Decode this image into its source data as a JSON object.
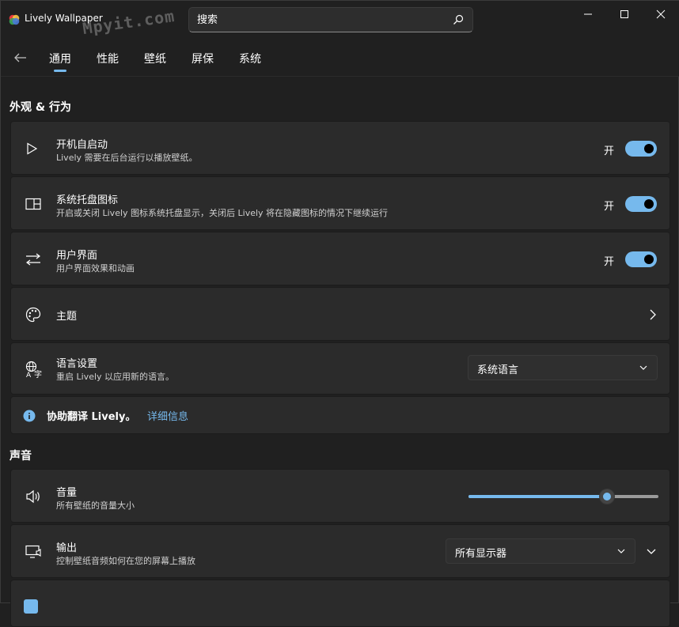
{
  "window": {
    "title": "Lively Wallpaper",
    "watermark": "Mpyit.com"
  },
  "search": {
    "placeholder": "搜索"
  },
  "nav": {
    "tabs": [
      {
        "label": "通用",
        "selected": true
      },
      {
        "label": "性能"
      },
      {
        "label": "壁纸"
      },
      {
        "label": "屏保"
      },
      {
        "label": "系统"
      }
    ]
  },
  "colors": {
    "accent": "#76b9ed",
    "background": "#202020",
    "card": "#2b2b2b"
  },
  "appearance": {
    "section_title": "外观 & 行为",
    "startup": {
      "title": "开机自启动",
      "desc": "Lively 需要在后台运行以播放壁纸。",
      "toggle_label": "开",
      "on": true
    },
    "tray": {
      "title": "系统托盘图标",
      "desc": "开启或关闭 Lively 图标系统托盘显示，关闭后 Lively 将在隐藏图标的情况下继续运行",
      "toggle_label": "开",
      "on": true
    },
    "ui": {
      "title": "用户界面",
      "desc": "用户界面效果和动画",
      "toggle_label": "开",
      "on": true
    },
    "theme": {
      "title": "主题"
    },
    "language": {
      "title": "语言设置",
      "desc": "重启 Lively 以应用新的语言。",
      "selected": "系统语言"
    },
    "translate": {
      "text": "协助翻译 Lively。",
      "link": "详细信息"
    }
  },
  "sound": {
    "section_title": "声音",
    "volume": {
      "title": "音量",
      "desc": "所有壁纸的音量大小",
      "level": 0.73
    },
    "output": {
      "title": "输出",
      "desc": "控制壁纸音频如何在您的屏幕上播放",
      "selected": "所有显示器"
    }
  }
}
